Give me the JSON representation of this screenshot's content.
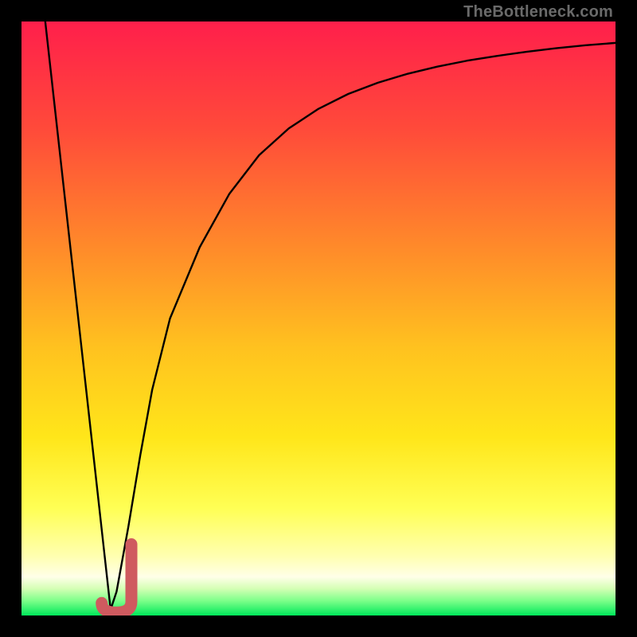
{
  "watermark": "TheBottleneck.com",
  "colors": {
    "frame": "#000000",
    "gradient_top": "#ff1f4b",
    "gradient_mid_upper": "#ff7a2e",
    "gradient_mid": "#ffd21f",
    "gradient_lower": "#ffff6a",
    "gradient_pale": "#ffffe0",
    "gradient_bottom": "#00e85a",
    "curve": "#000000",
    "marker": "#cf5a5f"
  },
  "chart_data": {
    "type": "line",
    "title": "",
    "xlabel": "",
    "ylabel": "",
    "xlim": [
      0,
      100
    ],
    "ylim": [
      0,
      100
    ],
    "series": [
      {
        "name": "bottleneck-curve",
        "x": [
          4,
          6,
          8,
          10,
          12,
          14,
          15,
          16,
          18,
          20,
          22,
          25,
          30,
          35,
          40,
          45,
          50,
          55,
          60,
          65,
          70,
          75,
          80,
          85,
          90,
          95,
          100
        ],
        "values": [
          100,
          82,
          64,
          46,
          28,
          10,
          1,
          4,
          15,
          27,
          38,
          50,
          62,
          71,
          77.5,
          82,
          85.3,
          87.8,
          89.7,
          91.2,
          92.4,
          93.4,
          94.2,
          94.9,
          95.5,
          96,
          96.4
        ]
      }
    ],
    "marker": {
      "name": "selected-point",
      "shape": "J",
      "x_range": [
        13.5,
        18.5
      ],
      "y_range": [
        0.5,
        12
      ],
      "color": "#cf5a5f"
    }
  }
}
